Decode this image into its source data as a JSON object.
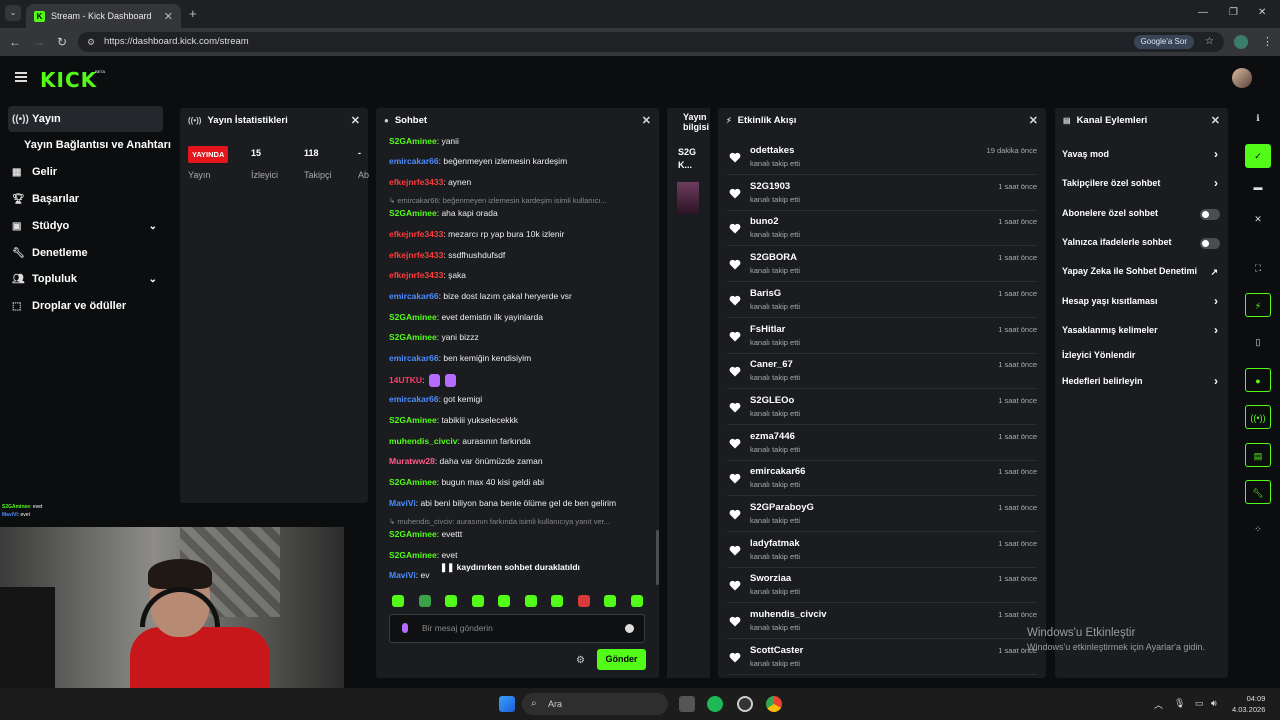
{
  "browser": {
    "tab_title": "Stream - Kick Dashboard",
    "tab_close": "✕",
    "new_tab": "+",
    "url": "https://dashboard.kick.com/stream",
    "google_sor": "Google'a Sor"
  },
  "header": {
    "logo": "KICK",
    "beta": "BETA"
  },
  "sidebar": {
    "items": [
      {
        "label": "Yayın",
        "icon": "broadcast-icon"
      },
      {
        "label": "Yayın Bağlantısı ve Anahtarı"
      },
      {
        "label": "Gelir",
        "icon": "revenue-icon"
      },
      {
        "label": "Başarılar",
        "icon": "trophy-icon"
      },
      {
        "label": "Stüdyo",
        "icon": "studio-icon"
      },
      {
        "label": "Denetleme",
        "icon": "wrench-icon"
      },
      {
        "label": "Topluluk",
        "icon": "community-icon"
      },
      {
        "label": "Droplar ve ödüller",
        "icon": "drops-icon"
      }
    ]
  },
  "stats_panel": {
    "title": "Yayın İstatistikleri",
    "live": "YAYINDA",
    "viewers": "15",
    "followers": "118",
    "dash": "-",
    "label_yayin": "Yayın",
    "label_viewers": "İzleyici",
    "label_followers": "Takipçi",
    "label_cut": "Ab"
  },
  "chat_panel": {
    "title": "Sohbet",
    "messages": [
      {
        "user": "S2GAminee",
        "text": ": yanii",
        "color": "#53fc18"
      },
      {
        "user": "emircakar66",
        "text": ": beğenmeyen izlemesin kardeşim",
        "color": "#4c8dff"
      },
      {
        "user": "efkejnrfe3433",
        "text": ": aynen",
        "color": "#ff3b3b"
      },
      {
        "reply": "↳ emircakar66: beğenmeyen izlemesin kardeşim isimli kullanıcı..."
      },
      {
        "user": "S2GAminee",
        "text": ": aha kapi orada",
        "color": "#53fc18"
      },
      {
        "user": "efkejnrfe3433",
        "text": ": mezarcı rp yap bura 10k izlenir",
        "color": "#ff3b3b"
      },
      {
        "user": "efkejnrfe3433",
        "text": ": ssdfhushdufsdf",
        "color": "#ff3b3b"
      },
      {
        "user": "efkejnrfe3433",
        "text": ": şaka",
        "color": "#ff3b3b"
      },
      {
        "user": "emircakar66",
        "text": ": bize dost lazım çakal heryerde vsr",
        "color": "#4c8dff"
      },
      {
        "user": "S2GAminee",
        "text": ": evet demistin ilk yayinlarda",
        "color": "#53fc18"
      },
      {
        "user": "S2GAminee",
        "text": ": yani bizzz",
        "color": "#53fc18"
      },
      {
        "user": "emircakar66",
        "text": ": ben kemiğin kendisiyim",
        "color": "#4c8dff"
      },
      {
        "user": "14UTKU",
        "text": ":",
        "color": "#ff3b6b"
      },
      {
        "user": "emircakar66",
        "text": ": got kemigi",
        "color": "#4c8dff"
      },
      {
        "user": "S2GAminee",
        "text": ": tabikiii yukselecekkk",
        "color": "#53fc18"
      },
      {
        "user": "muhendis_civciv",
        "text": ": aurasının farkında",
        "color": "#53fc18"
      },
      {
        "user": "Muratww28",
        "text": ": daha var önümüzde zaman",
        "color": "#ff5c8a"
      },
      {
        "user": "S2GAminee",
        "text": ": bugun max 40 kisi geldi abi",
        "color": "#53fc18"
      },
      {
        "user": "MaviVi",
        "text": ": abi beni biliyon bana benle ölüme gel de ben gelirim",
        "color": "#4c8dff"
      },
      {
        "reply": "↳ muhendis_civciv: aurasının farkında isimli kullanıcıya yanıt ver..."
      },
      {
        "user": "S2GAminee",
        "text": ": evettt",
        "color": "#53fc18"
      },
      {
        "user": "S2GAminee",
        "text": ": evet",
        "color": "#53fc18"
      },
      {
        "user": "MaviVi",
        "text": ": ev",
        "color": "#4c8dff"
      }
    ],
    "paused": "kaydırırken sohbet duraklatıldı",
    "placeholder": "Bir mesaj gönderin",
    "send": "Gönder"
  },
  "info_panel": {
    "title_1": "Yayın",
    "title_2": "bilgisi",
    "short_1": "S2G",
    "short_2": "K..."
  },
  "activity_panel": {
    "title": "Etkinlik Akışı",
    "subtitle": "kanalı takip etti",
    "items": [
      {
        "name": "odettakes",
        "time": "19 dakika önce"
      },
      {
        "name": "S2G1903",
        "time": "1 saat önce"
      },
      {
        "name": "buno2",
        "time": "1 saat önce"
      },
      {
        "name": "S2GBORA",
        "time": "1 saat önce"
      },
      {
        "name": "BarisG",
        "time": "1 saat önce"
      },
      {
        "name": "FsHitlar",
        "time": "1 saat önce"
      },
      {
        "name": "Caner_67",
        "time": "1 saat önce"
      },
      {
        "name": "S2GLEOo",
        "time": "1 saat önce"
      },
      {
        "name": "ezma7446",
        "time": "1 saat önce"
      },
      {
        "name": "emircakar66",
        "time": "1 saat önce"
      },
      {
        "name": "S2GParaboyG",
        "time": "1 saat önce"
      },
      {
        "name": "ladyfatmak",
        "time": "1 saat önce"
      },
      {
        "name": "Sworziaa",
        "time": "1 saat önce"
      },
      {
        "name": "muhendis_civciv",
        "time": "1 saat önce"
      },
      {
        "name": "ScottCaster",
        "time": "1 saat önce"
      }
    ]
  },
  "channel_panel": {
    "title": "Kanal Eylemleri",
    "rows": [
      {
        "label": "Yavaş mod",
        "kind": "arrow"
      },
      {
        "label": "Takipçilere özel sohbet",
        "kind": "arrow"
      },
      {
        "label": "Abonelere özel sohbet",
        "kind": "toggle"
      },
      {
        "label": "Yalnızca ifadelerle sohbet",
        "kind": "toggle"
      },
      {
        "label": "Yapay Zeka ile Sohbet Denetimi",
        "kind": "external"
      },
      {
        "label": "Hesap yaşı kısıtlaması",
        "kind": "arrow"
      },
      {
        "label": "Yasaklanmış kelimeler",
        "kind": "arrow"
      },
      {
        "label": "İzleyici Yönlendir",
        "kind": "none"
      },
      {
        "label": "Hedefleri belirleyin",
        "kind": "arrow"
      }
    ]
  },
  "overlay_chat": [
    {
      "user": "S2GAminee",
      "text": ": evet"
    },
    {
      "user": "MaviVi",
      "text": ": evet"
    }
  ],
  "watermark": {
    "line1": "Windows'u Etkinleştir",
    "line2": "Windows'u etkinleştirmek için Ayarlar'a gidin."
  },
  "taskbar": {
    "search": "Ara",
    "time": "04:09",
    "date": "4.03.2026"
  },
  "colors": {
    "kick_green": "#53fc18",
    "live_red": "#e3161b"
  }
}
